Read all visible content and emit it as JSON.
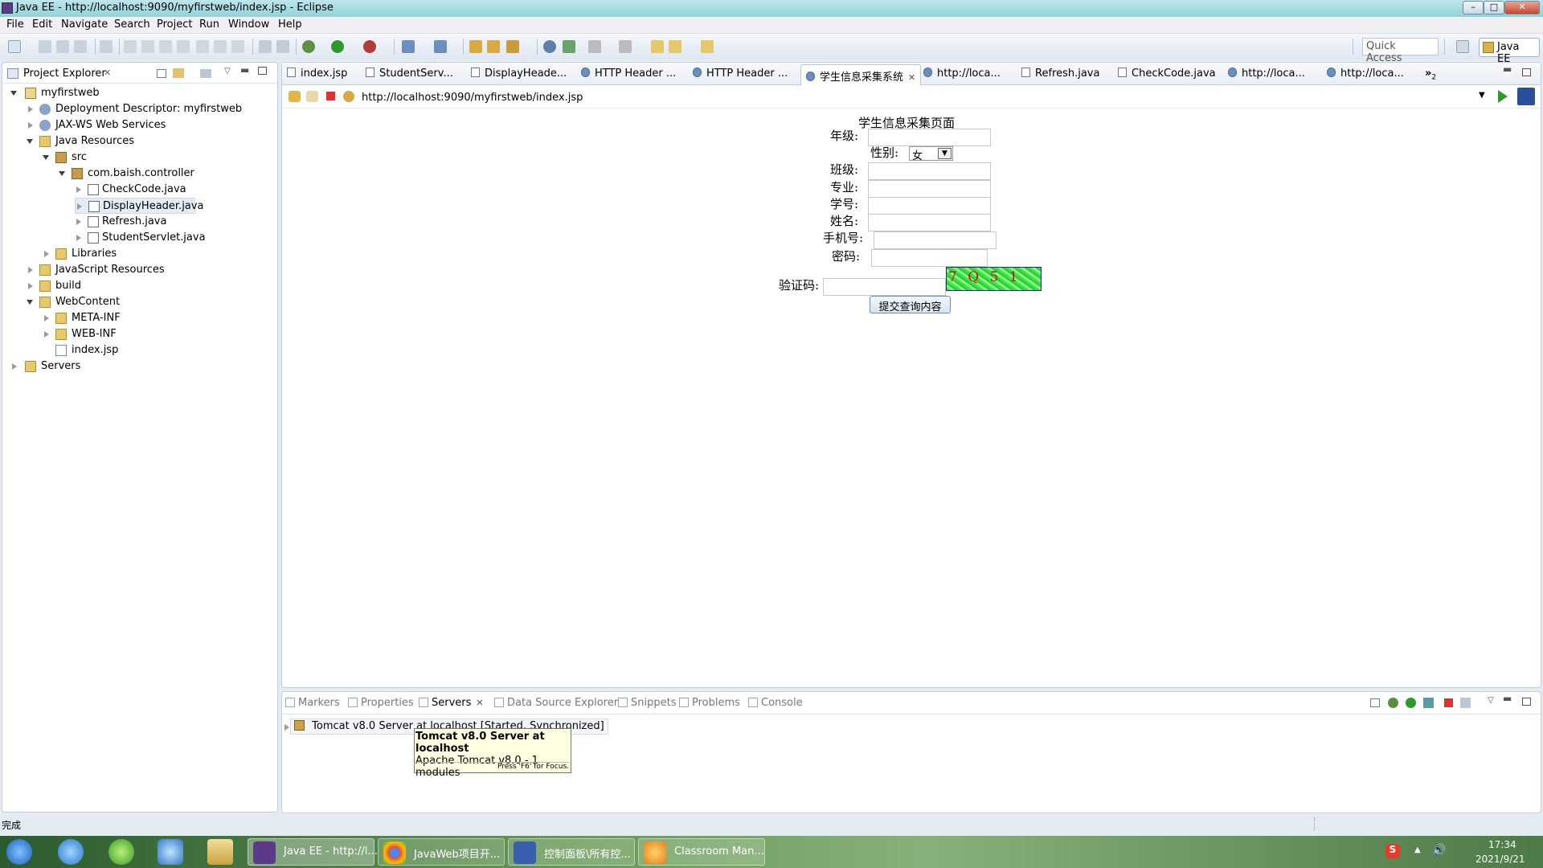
{
  "window": {
    "title": "Java EE - http://localhost:9090/myfirstweb/index.jsp - Eclipse"
  },
  "menubar": {
    "items": [
      "File",
      "Edit",
      "Navigate",
      "Search",
      "Project",
      "Run",
      "Window",
      "Help"
    ]
  },
  "toolbar": {
    "quick_access": "Quick Access",
    "perspective": "Java EE"
  },
  "project_explorer": {
    "title": "Project Explorer",
    "tree": [
      {
        "label": "myfirstweb"
      },
      {
        "label": "Deployment Descriptor: myfirstweb"
      },
      {
        "label": "JAX-WS Web Services"
      },
      {
        "label": "Java Resources"
      },
      {
        "label": "src"
      },
      {
        "label": "com.baish.controller"
      },
      {
        "label": "CheckCode.java"
      },
      {
        "label": "DisplayHeader.java"
      },
      {
        "label": "Refresh.java"
      },
      {
        "label": "StudentServlet.java"
      },
      {
        "label": "Libraries"
      },
      {
        "label": "JavaScript Resources"
      },
      {
        "label": "build"
      },
      {
        "label": "WebContent"
      },
      {
        "label": "META-INF"
      },
      {
        "label": "WEB-INF"
      },
      {
        "label": "index.jsp"
      },
      {
        "label": "Servers"
      }
    ]
  },
  "editor": {
    "tabs": [
      {
        "label": "index.jsp"
      },
      {
        "label": "StudentServ..."
      },
      {
        "label": "DisplayHeade..."
      },
      {
        "label": "HTTP Header ..."
      },
      {
        "label": "HTTP Header ..."
      },
      {
        "label": "学生信息采集系统"
      },
      {
        "label": "http://loca..."
      },
      {
        "label": "Refresh.java"
      },
      {
        "label": "CheckCode.java"
      },
      {
        "label": "http://loca..."
      },
      {
        "label": "http://loca..."
      }
    ],
    "overflow_count": "2",
    "url": "http://localhost:9090/myfirstweb/index.jsp"
  },
  "form": {
    "heading": "学生信息采集页面",
    "grade_label": "年级:",
    "gender_label": "性别:",
    "gender_value": "女",
    "class_label": "班级:",
    "major_label": "专业:",
    "student_id_label": "学号:",
    "name_label": "姓名:",
    "phone_label": "手机号:",
    "password_label": "密码:",
    "captcha_label": "验证码:",
    "captcha_text": "7 Q 5 1",
    "submit_label": "提交查询内容"
  },
  "bottom_panel": {
    "tabs": [
      "Markers",
      "Properties",
      "Servers",
      "Data Source Explorer",
      "Snippets",
      "Problems",
      "Console"
    ],
    "server_entry": "Tomcat v8.0 Server at localhost  [Started, Synchronized]",
    "tooltip": {
      "title": "Tomcat v8.0 Server at localhost",
      "line": "Apache Tomcat v8.0 - 1 modules",
      "hint": "Press 'F6' for Focus."
    }
  },
  "status": {
    "text": "完成"
  },
  "taskbar": {
    "tasks": [
      "Java EE - http://l...",
      "JavaWeb项目开...",
      "控制面板\\所有控...",
      "Classroom Man..."
    ],
    "time": "17:34",
    "date": "2021/9/21"
  }
}
